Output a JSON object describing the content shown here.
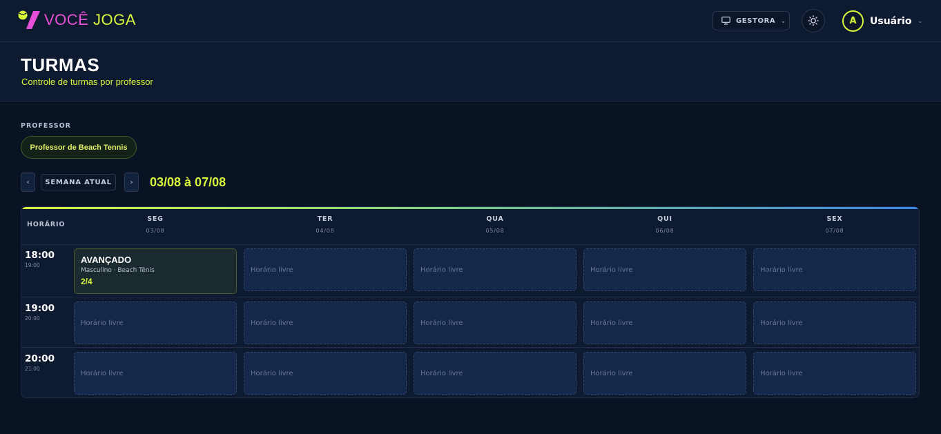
{
  "brand": {
    "voce": "VOCÊ",
    "joga": "JOGA"
  },
  "topbar": {
    "role_label": "GESTORA",
    "user_initial": "A",
    "user_name": "Usuário"
  },
  "header": {
    "title": "TURMAS",
    "subtitle": "Controle de turmas por professor"
  },
  "filter": {
    "professor_label": "PROFESSOR",
    "professor_selected": "Professor de Beach Tennis"
  },
  "week_nav": {
    "prev": "‹",
    "current_label": "SEMANA ATUAL",
    "next": "›",
    "range": "03/08 à 07/08"
  },
  "schedule": {
    "time_column_label": "HORÁRIO",
    "free_label": "Horário livre",
    "days": [
      {
        "name": "SEG",
        "date": "03/08"
      },
      {
        "name": "TER",
        "date": "04/08"
      },
      {
        "name": "QUA",
        "date": "05/08"
      },
      {
        "name": "QUI",
        "date": "06/08"
      },
      {
        "name": "SEX",
        "date": "07/08"
      }
    ],
    "rows": [
      {
        "start": "18:00",
        "end": "19:00"
      },
      {
        "start": "19:00",
        "end": "20:00"
      },
      {
        "start": "20:00",
        "end": "21:00"
      }
    ],
    "classes": [
      {
        "title": "AVANÇADO",
        "details": "Masculino · Beach Tênis",
        "occupancy": "2/4"
      }
    ]
  },
  "colors": {
    "accent": "#d9f73a",
    "brand_pink": "#e84fd8",
    "background": "#0a1324",
    "panel": "#0e1a30"
  }
}
